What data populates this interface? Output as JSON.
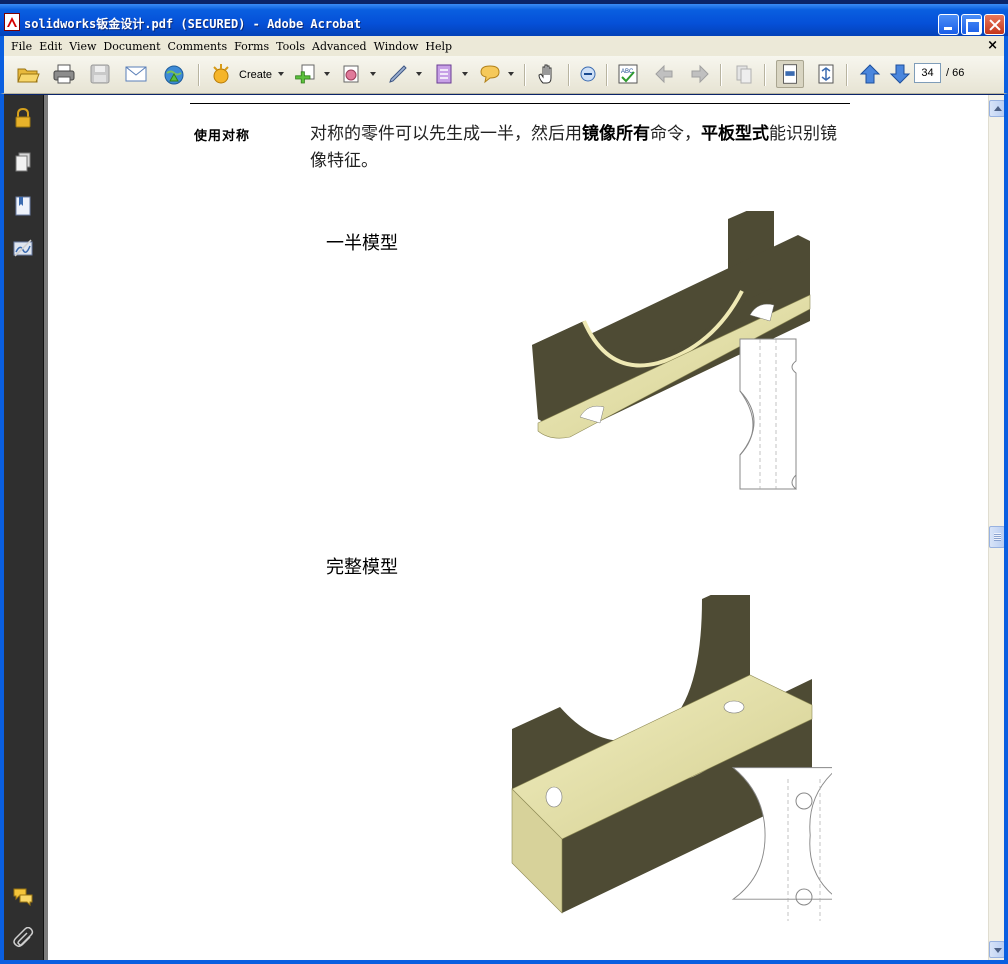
{
  "window": {
    "title": "solidworks钣金设计.pdf (SECURED) - Adobe Acrobat"
  },
  "menu": {
    "items": [
      "File",
      "Edit",
      "View",
      "Document",
      "Comments",
      "Forms",
      "Tools",
      "Advanced",
      "Window",
      "Help"
    ],
    "close_glyph": "×"
  },
  "toolbar": {
    "create_label": "Create",
    "page_current": "34",
    "page_total": "/ 66"
  },
  "document": {
    "side_label": "使用对称",
    "body_prefix": "对称的零件可以先生成一半，然后用",
    "body_bold_1": "镜像所有",
    "body_mid": "命令，",
    "body_bold_2": "平板型式",
    "body_suffix": "能识别镜像特征。",
    "heading_half": "一半模型",
    "heading_full": "完整模型"
  },
  "colors": {
    "titlebar": "#0550d8",
    "navpanel": "#2f2f2f",
    "sheet_light": "#e7e3b0",
    "sheet_dark": "#4e4b34"
  }
}
